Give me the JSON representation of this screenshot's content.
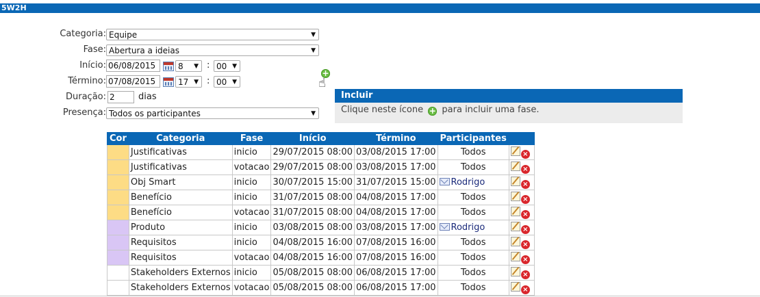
{
  "window": {
    "title": "5W2H"
  },
  "form": {
    "categoria": {
      "label": "Categoria:",
      "value": "Equipe"
    },
    "fase": {
      "label": "Fase:",
      "value": "Abertura a ideias"
    },
    "inicio": {
      "label": "Início:",
      "date": "06/08/2015",
      "hour": "8",
      "minute": "00"
    },
    "termino": {
      "label": "Término:",
      "date": "07/08/2015",
      "hour": "17",
      "minute": "00"
    },
    "duracao": {
      "label": "Duração:",
      "value": "2",
      "unit": "dias"
    },
    "presenca": {
      "label": "Presença:",
      "value": "Todos os participantes"
    },
    "time_separator": ":"
  },
  "tooltip": {
    "title": "Incluir",
    "text_before": "Clique neste ícone",
    "text_after": "para incluir uma fase."
  },
  "table": {
    "headers": [
      "Cor",
      "Categoria",
      "Fase",
      "Início",
      "Término",
      "Participantes"
    ],
    "rows": [
      {
        "color": "#fddc85",
        "categoria": "Justificativas",
        "fase": "inicio",
        "inicio": "29/07/2015 08:00",
        "termino": "03/08/2015 17:00",
        "participantes": "Todos",
        "type": "all"
      },
      {
        "color": "#fddc85",
        "categoria": "Justificativas",
        "fase": "votacao",
        "inicio": "29/07/2015 08:00",
        "termino": "03/08/2015 17:00",
        "participantes": "Todos",
        "type": "all"
      },
      {
        "color": "#fddc85",
        "categoria": "Obj Smart",
        "fase": "inicio",
        "inicio": "30/07/2015 15:00",
        "termino": "31/07/2015 15:00",
        "participantes": "Rodrigo",
        "type": "person"
      },
      {
        "color": "#fddc85",
        "categoria": "Benefício",
        "fase": "inicio",
        "inicio": "31/07/2015 08:00",
        "termino": "04/08/2015 17:00",
        "participantes": "Todos",
        "type": "all"
      },
      {
        "color": "#fddc85",
        "categoria": "Benefício",
        "fase": "votacao",
        "inicio": "31/07/2015 08:00",
        "termino": "04/08/2015 17:00",
        "participantes": "Todos",
        "type": "all"
      },
      {
        "color": "#d9c6f5",
        "categoria": "Produto",
        "fase": "inicio",
        "inicio": "03/08/2015 08:00",
        "termino": "03/08/2015 17:00",
        "participantes": "Rodrigo",
        "type": "person"
      },
      {
        "color": "#d9c6f5",
        "categoria": "Requisitos",
        "fase": "inicio",
        "inicio": "04/08/2015 16:00",
        "termino": "07/08/2015 16:00",
        "participantes": "Todos",
        "type": "all"
      },
      {
        "color": "#d9c6f5",
        "categoria": "Requisitos",
        "fase": "votacao",
        "inicio": "04/08/2015 16:00",
        "termino": "07/08/2015 16:00",
        "participantes": "Todos",
        "type": "all"
      },
      {
        "color": "#ffffff",
        "categoria": "Stakeholders Externos",
        "fase": "inicio",
        "inicio": "05/08/2015 08:00",
        "termino": "06/08/2015 17:00",
        "participantes": "Todos",
        "type": "all"
      },
      {
        "color": "#ffffff",
        "categoria": "Stakeholders Externos",
        "fase": "votacao",
        "inicio": "05/08/2015 08:00",
        "termino": "06/08/2015 17:00",
        "participantes": "Todos",
        "type": "all"
      }
    ]
  },
  "icons": {
    "calendar": "calendar-icon",
    "add": "add-phase-icon",
    "cursor": "hand-cursor-icon",
    "edit": "edit-icon",
    "delete": "delete-icon",
    "person": "participant-icon"
  }
}
